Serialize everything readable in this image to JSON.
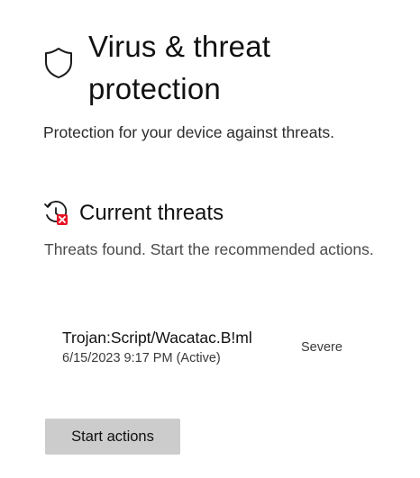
{
  "header": {
    "title": "Virus & threat protection",
    "subtitle": "Protection for your device against threats.",
    "icon": "shield-icon"
  },
  "current_threats": {
    "heading": "Current threats",
    "icon": "history-alert-icon",
    "description": "Threats found. Start the recommended actions.",
    "items": [
      {
        "name": "Trojan:Script/Wacatac.B!ml",
        "date": "6/15/2023 9:17 PM (Active)",
        "severity": "Severe"
      }
    ],
    "action_label": "Start actions"
  },
  "colors": {
    "alert_badge": "#e81123",
    "button_bg": "#cccccc"
  }
}
